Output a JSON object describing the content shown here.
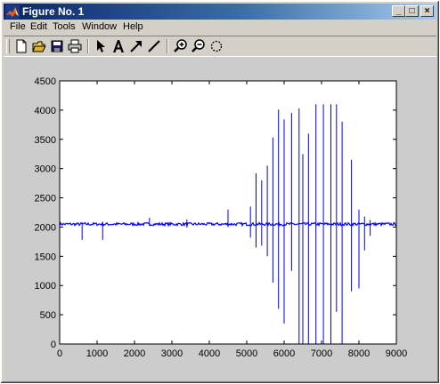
{
  "window": {
    "title": "Figure No. 1"
  },
  "title_buttons": {
    "minimize": "_",
    "maximize": "□",
    "close": "×"
  },
  "menu": [
    "File",
    "Edit",
    "Tools",
    "Window",
    "Help"
  ],
  "toolbar": {
    "icons": [
      "new-file-icon",
      "open-folder-icon",
      "save-icon",
      "print-icon",
      "select-arrow-icon",
      "insert-text-icon",
      "insert-arrow-icon",
      "insert-line-icon",
      "zoom-in-icon",
      "zoom-out-icon",
      "rotate-3d-icon"
    ]
  },
  "colors": {
    "title_start": "#0a246a",
    "title_end": "#a6caf0",
    "figure_bg": "#cccccc",
    "axes_bg": "#ffffff",
    "line": "#0000ff"
  },
  "chart_data": {
    "type": "line",
    "title": "",
    "xlabel": "",
    "ylabel": "",
    "xlim": [
      0,
      9000
    ],
    "ylim": [
      0,
      4500
    ],
    "xticks": [
      0,
      1000,
      2000,
      3000,
      4000,
      5000,
      6000,
      7000,
      8000,
      9000
    ],
    "yticks": [
      0,
      500,
      1000,
      1500,
      2000,
      2500,
      3000,
      3500,
      4000,
      4500
    ],
    "grid": false,
    "baseline": 2050,
    "baseline_noise": 25,
    "spikes": [
      {
        "x": 600,
        "y_min": 1780,
        "y_max": 2080
      },
      {
        "x": 1150,
        "y_min": 1780,
        "y_max": 2090
      },
      {
        "x": 2400,
        "y_min": 2020,
        "y_max": 2160
      },
      {
        "x": 3400,
        "y_min": 1990,
        "y_max": 2130
      },
      {
        "x": 4500,
        "y_min": 2000,
        "y_max": 2300
      },
      {
        "x": 5100,
        "y_min": 1820,
        "y_max": 2350
      },
      {
        "x": 5250,
        "y_min": 1650,
        "y_max": 2920
      },
      {
        "x": 5400,
        "y_min": 1680,
        "y_max": 2800
      },
      {
        "x": 5550,
        "y_min": 1500,
        "y_max": 3050
      },
      {
        "x": 5700,
        "y_min": 1050,
        "y_max": 3530
      },
      {
        "x": 5850,
        "y_min": 600,
        "y_max": 4010
      },
      {
        "x": 6000,
        "y_min": 350,
        "y_max": 3840
      },
      {
        "x": 6200,
        "y_min": 1250,
        "y_max": 3950
      },
      {
        "x": 6400,
        "y_min": 0,
        "y_max": 4030
      },
      {
        "x": 6500,
        "y_min": 0,
        "y_max": 3250
      },
      {
        "x": 6650,
        "y_min": 0,
        "y_max": 3600
      },
      {
        "x": 6850,
        "y_min": 0,
        "y_max": 4100
      },
      {
        "x": 7050,
        "y_min": 0,
        "y_max": 4100
      },
      {
        "x": 7250,
        "y_min": 0,
        "y_max": 4100
      },
      {
        "x": 7400,
        "y_min": 550,
        "y_max": 4100
      },
      {
        "x": 7550,
        "y_min": 0,
        "y_max": 3800
      },
      {
        "x": 7800,
        "y_min": 900,
        "y_max": 3150
      },
      {
        "x": 8000,
        "y_min": 950,
        "y_max": 2300
      },
      {
        "x": 8150,
        "y_min": 1600,
        "y_max": 2180
      },
      {
        "x": 8300,
        "y_min": 1850,
        "y_max": 2120
      }
    ]
  }
}
